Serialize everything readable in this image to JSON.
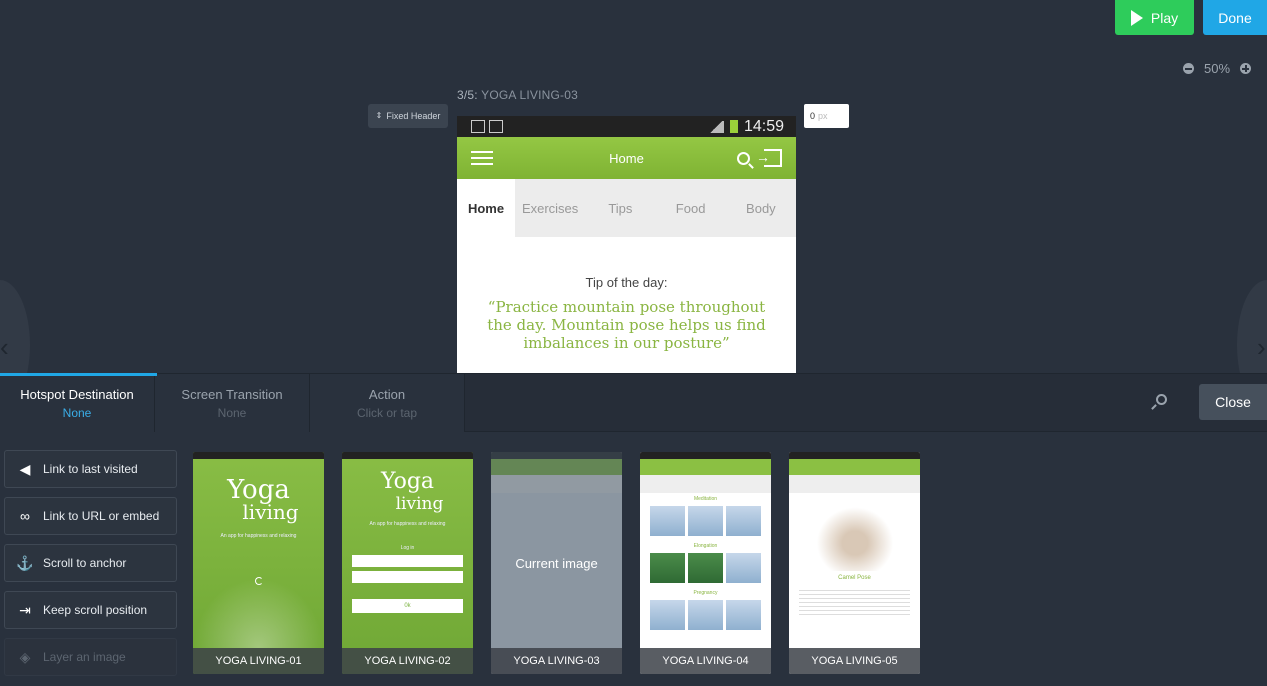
{
  "toolbar": {
    "play_label": "Play",
    "done_label": "Done",
    "zoom": "50%"
  },
  "screen": {
    "counter": "3/5:",
    "name": "YOGA LIVING-03"
  },
  "fixed_header": {
    "label": "Fixed Header"
  },
  "offset": {
    "value": "0",
    "unit": "px"
  },
  "phone": {
    "time": "14:59",
    "title": "Home",
    "tabs": [
      "Home",
      "Exercises",
      "Tips",
      "Food",
      "Body"
    ],
    "tip_heading": "Tip of the day:",
    "tip_text": "“Practice mountain pose throughout the day.  Mountain pose helps us find imbalances in our posture”"
  },
  "panel": {
    "tabs": [
      {
        "label": "Hotspot Destination",
        "value": "None"
      },
      {
        "label": "Screen Transition",
        "value": "None"
      },
      {
        "label": "Action",
        "value": "Click or tap"
      }
    ],
    "close_label": "Close",
    "hotspot_options": [
      {
        "label": "Link to last visited",
        "icon": "arrow-left-icon"
      },
      {
        "label": "Link to URL or embed",
        "icon": "link-icon"
      },
      {
        "label": "Scroll to anchor",
        "icon": "anchor-icon"
      },
      {
        "label": "Keep scroll position",
        "icon": "scroll-position-icon"
      },
      {
        "label": "Layer an image",
        "icon": "layers-icon"
      }
    ],
    "thumbnails": [
      {
        "name": "YOGA LIVING-01",
        "logo_top": "Yoga",
        "logo_bottom": "living",
        "subtitle": "An app for happiness and relaxing"
      },
      {
        "name": "YOGA LIVING-02",
        "logo_top": "Yoga",
        "logo_bottom": "living",
        "subtitle": "An app for happiness and relaxing",
        "login_label": "Log in",
        "ok_label": "0k"
      },
      {
        "name": "YOGA LIVING-03",
        "overlay": "Current image"
      },
      {
        "name": "YOGA LIVING-04",
        "sections": [
          "Meditation",
          "Elongation",
          "Pregnancy"
        ]
      },
      {
        "name": "YOGA LIVING-05",
        "pose_title": "Camel Pose"
      }
    ]
  }
}
